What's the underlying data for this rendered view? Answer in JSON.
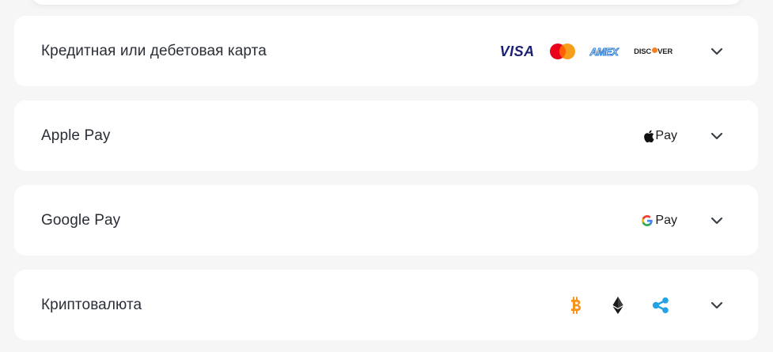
{
  "payment_methods": [
    {
      "label": "Кредитная или дебетовая карта",
      "icons": [
        "visa-logo",
        "mastercard-logo",
        "amex-logo",
        "discover-logo"
      ],
      "visa_text": "VISA",
      "amex_text": "AMEX",
      "discover_text_a": "DISC",
      "discover_text_b": "VER"
    },
    {
      "label": "Apple Pay",
      "icons": [
        "apple-pay-logo"
      ],
      "pay_text": "Pay"
    },
    {
      "label": "Google Pay",
      "icons": [
        "google-pay-logo"
      ],
      "pay_text": "Pay"
    },
    {
      "label": "Криптовалюта",
      "icons": [
        "bitcoin-icon",
        "ethereum-icon",
        "ripple-icon"
      ]
    }
  ],
  "colors": {
    "page_background": "#f6f6f7",
    "card_background": "#ffffff",
    "label_text": "#2a2e36",
    "chevron": "#3b4048",
    "visa_blue": "#1a1f71",
    "mastercard_red": "#eb001b",
    "mastercard_orange": "#f79e1b",
    "amex_blue": "#2f7fd6",
    "discover_orange": "#f68121",
    "bitcoin_orange": "#f7931a",
    "ethereum_dark": "#1a1a1a",
    "ripple_blue": "#23a3e6"
  }
}
